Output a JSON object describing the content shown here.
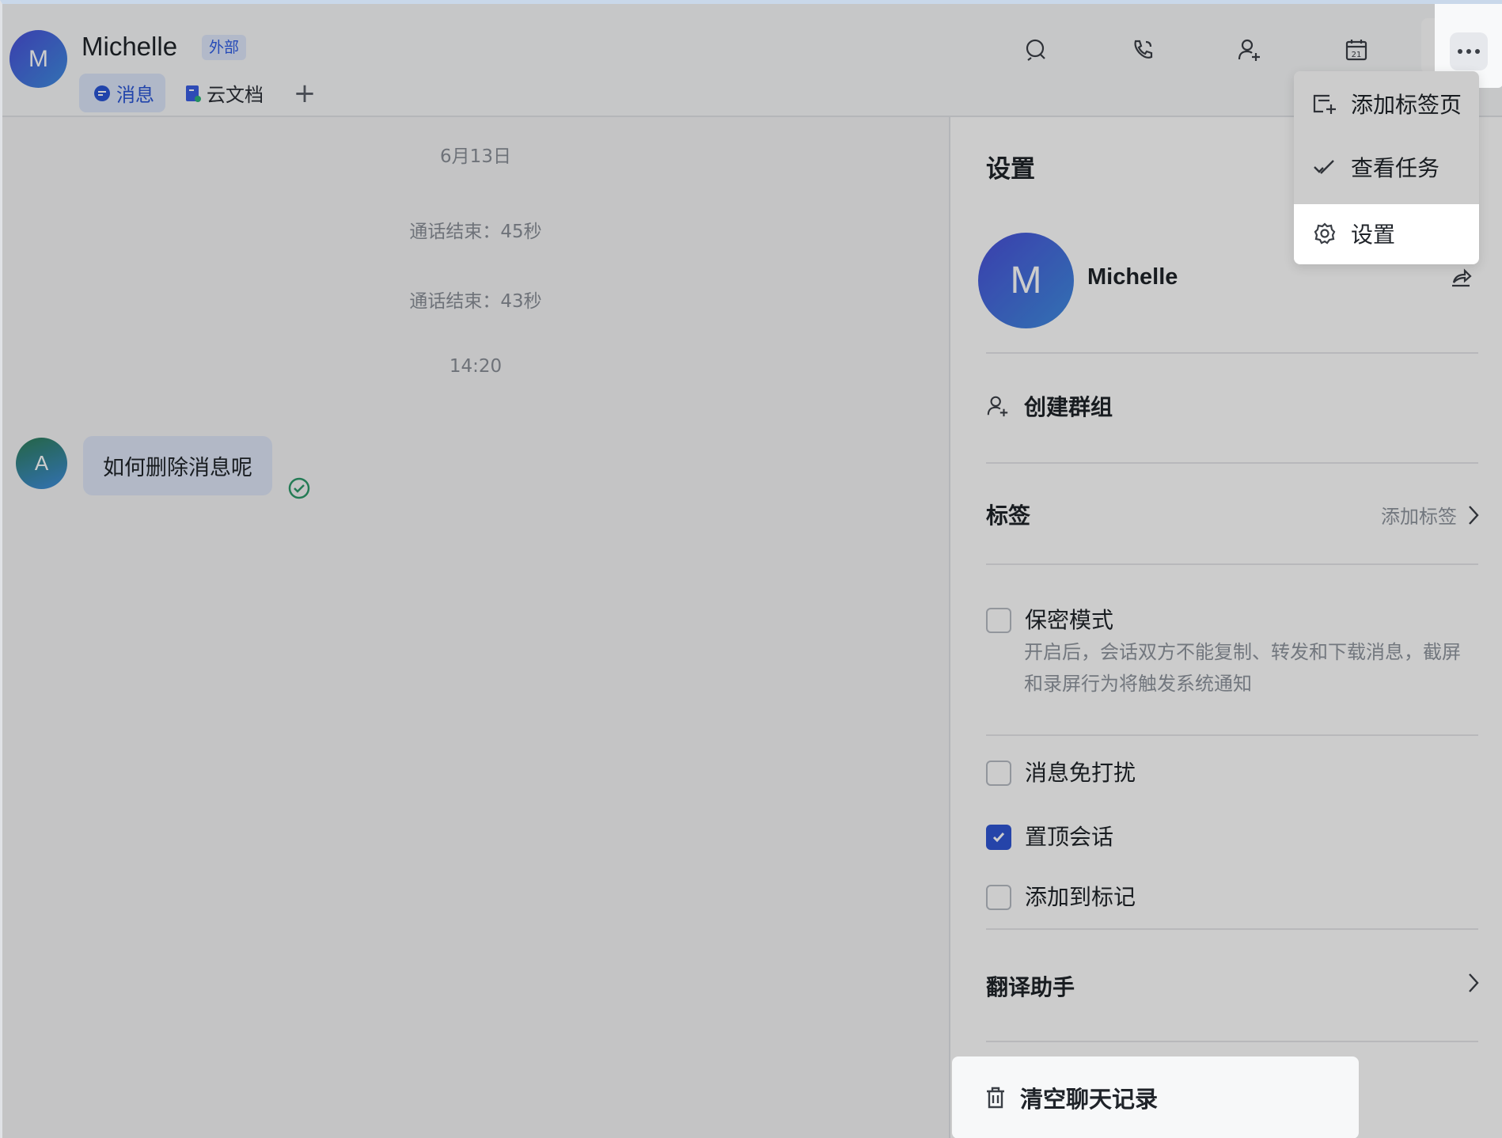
{
  "header": {
    "avatar_letter": "M",
    "name": "Michelle",
    "badge": "外部",
    "tabs": [
      {
        "label": "消息",
        "icon": "message-icon",
        "active": true
      },
      {
        "label": "云文档",
        "icon": "doc-icon",
        "active": false
      }
    ],
    "add_tab": "+",
    "icons": [
      "search-icon",
      "call-icon",
      "add-member-icon",
      "calendar-icon",
      "more-icon"
    ],
    "calendar_day": "21"
  },
  "chat": {
    "date": "6月13日",
    "call_ended_1": "通话结束：45秒",
    "call_ended_2": "通话结束：43秒",
    "time": "14:20",
    "message": {
      "avatar_letter": "A",
      "text": "如何删除消息呢",
      "status": "read"
    }
  },
  "menu": {
    "items": [
      {
        "label": "添加标签页",
        "icon": "add-tab-icon"
      },
      {
        "label": "查看任务",
        "icon": "task-check-icon"
      },
      {
        "label": "设置",
        "icon": "gear-icon"
      }
    ]
  },
  "settings": {
    "title": "设置",
    "profile_letter": "M",
    "profile_name": "Michelle",
    "create_group": "创建群组",
    "tag_label": "标签",
    "tag_action": "添加标签",
    "secret_mode": "保密模式",
    "secret_desc": "开启后，会话双方不能复制、转发和下载消息，截屏和录屏行为将触发系统通知",
    "mute": "消息免打扰",
    "pin": "置顶会话",
    "bookmark": "添加到标记",
    "pin_checked": true,
    "translate": "翻译助手",
    "clear_history": "清空聊天记录"
  },
  "colors": {
    "accent": "#2f55d4",
    "badge_bg": "#dfe8fc",
    "read_check": "#2e9a6b"
  }
}
